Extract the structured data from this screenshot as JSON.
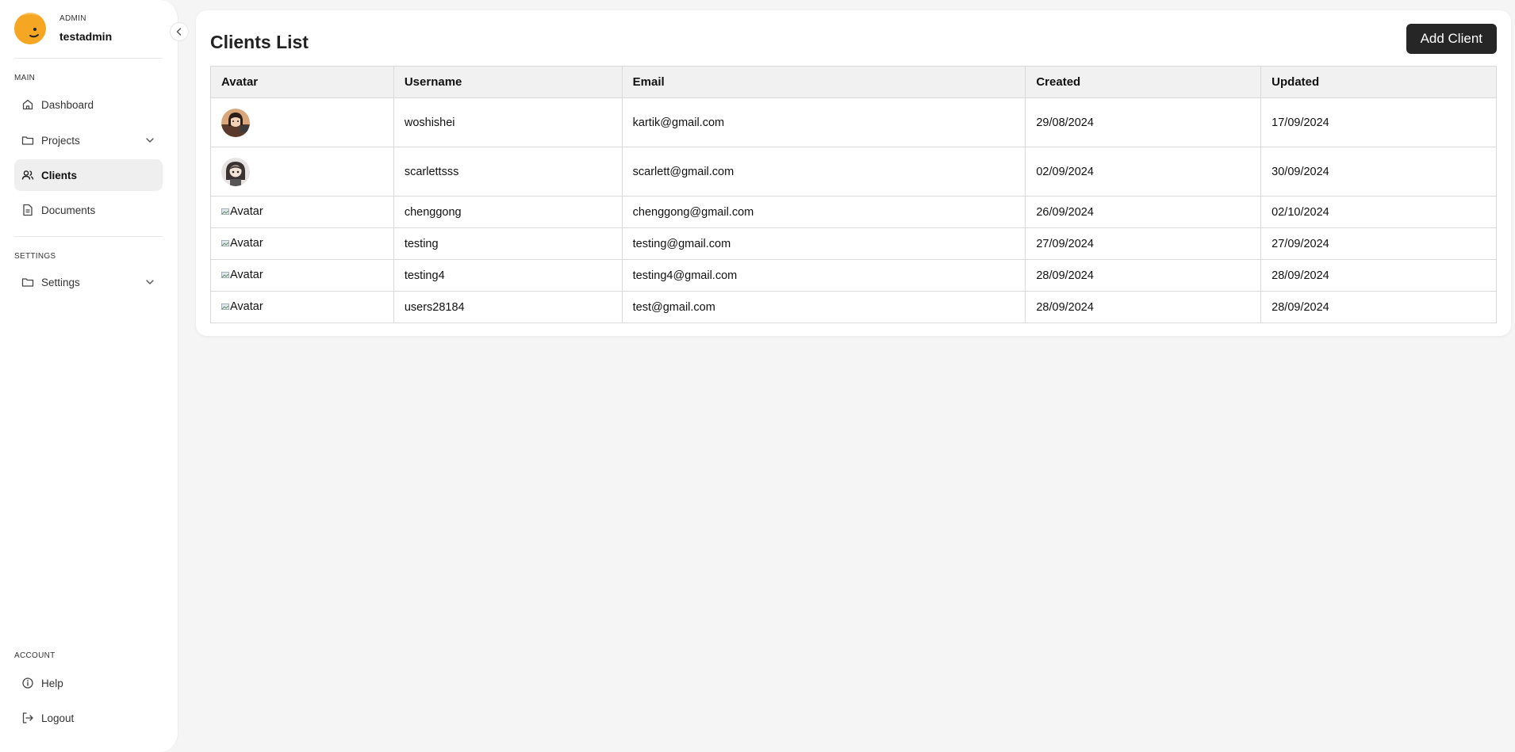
{
  "profile": {
    "role": "ADMIN",
    "name": "testadmin"
  },
  "nav": {
    "main_label": "MAIN",
    "main_items": [
      {
        "label": "Dashboard",
        "icon": "home-icon"
      },
      {
        "label": "Projects",
        "icon": "folder-icon",
        "expandable": true
      },
      {
        "label": "Clients",
        "icon": "users-icon",
        "active": true
      },
      {
        "label": "Documents",
        "icon": "document-icon"
      }
    ],
    "settings_label": "SETTINGS",
    "settings_items": [
      {
        "label": "Settings",
        "icon": "folder-icon",
        "expandable": true
      }
    ],
    "account_label": "ACCOUNT",
    "account_items": [
      {
        "label": "Help",
        "icon": "info-icon"
      },
      {
        "label": "Logout",
        "icon": "logout-icon"
      }
    ]
  },
  "page": {
    "title": "Clients List",
    "add_button": "Add Client"
  },
  "table": {
    "headers": [
      "Avatar",
      "Username",
      "Email",
      "Created",
      "Updated"
    ],
    "rows": [
      {
        "avatar": "image",
        "avatar_alt": "Avatar",
        "username": "woshishei",
        "email": "kartik@gmail.com",
        "created": "29/08/2024",
        "updated": "17/09/2024"
      },
      {
        "avatar": "image",
        "avatar_alt": "Avatar",
        "username": "scarlettsss",
        "email": "scarlett@gmail.com",
        "created": "02/09/2024",
        "updated": "30/09/2024"
      },
      {
        "avatar": "broken",
        "avatar_alt": "Avatar",
        "username": "chenggong",
        "email": "chenggong@gmail.com",
        "created": "26/09/2024",
        "updated": "02/10/2024"
      },
      {
        "avatar": "broken",
        "avatar_alt": "Avatar",
        "username": "testing",
        "email": "testing@gmail.com",
        "created": "27/09/2024",
        "updated": "27/09/2024"
      },
      {
        "avatar": "broken",
        "avatar_alt": "Avatar",
        "username": "testing4",
        "email": "testing4@gmail.com",
        "created": "28/09/2024",
        "updated": "28/09/2024"
      },
      {
        "avatar": "broken",
        "avatar_alt": "Avatar",
        "username": "users28184",
        "email": "test@gmail.com",
        "created": "28/09/2024",
        "updated": "28/09/2024"
      }
    ]
  },
  "colors": {
    "avatar_orange": "#f5a623",
    "button_dark": "#262626",
    "active_bg": "#efefef"
  }
}
